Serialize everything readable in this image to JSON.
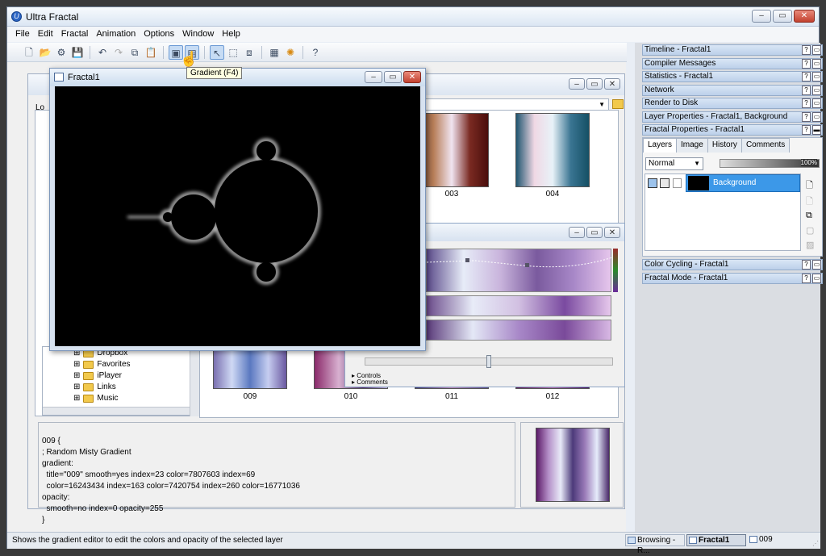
{
  "app": {
    "title": "Ultra Fractal"
  },
  "menu": [
    "File",
    "Edit",
    "Fractal",
    "Animation",
    "Options",
    "Window",
    "Help"
  ],
  "tooltip": "Gradient (F4)",
  "fractal_window": {
    "title": "Fractal1"
  },
  "browser": {
    "location_prefix": "Lo"
  },
  "thumbnails": {
    "top": [
      "003",
      "004"
    ],
    "bottom": [
      "009",
      "010",
      "011",
      "012"
    ]
  },
  "tree": [
    "Dropbox",
    "Favorites",
    "iPlayer",
    "Links",
    "Music"
  ],
  "gradient_editor": {
    "controls_label": "Controls",
    "comments_label": "Comments"
  },
  "code": {
    "lines": [
      "009 {",
      "; Random Misty Gradient",
      "gradient:",
      "  title=\"009\" smooth=yes index=23 color=7807603 index=69",
      "  color=16243434 index=163 color=7420754 index=260 color=16771036",
      "opacity:",
      "  smooth=no index=0 opacity=255",
      "}"
    ]
  },
  "right_panels": {
    "top": [
      "Timeline - Fractal1",
      "Compiler Messages",
      "Statistics - Fractal1",
      "Network",
      "Render to Disk",
      "Layer Properties - Fractal1, Background",
      "Fractal Properties - Fractal1"
    ],
    "bottom": [
      "Color Cycling - Fractal1",
      "Fractal Mode - Fractal1"
    ]
  },
  "fractal_properties": {
    "tabs": [
      "Layers",
      "Image",
      "History",
      "Comments"
    ],
    "blend_mode": "Normal",
    "opacity": "100%",
    "layer_name": "Background"
  },
  "status": {
    "message": "Shows the gradient editor to edit the colors and opacity of the selected layer",
    "browsing": "Browsing - R...",
    "fractal": "Fractal1",
    "item": "009"
  }
}
